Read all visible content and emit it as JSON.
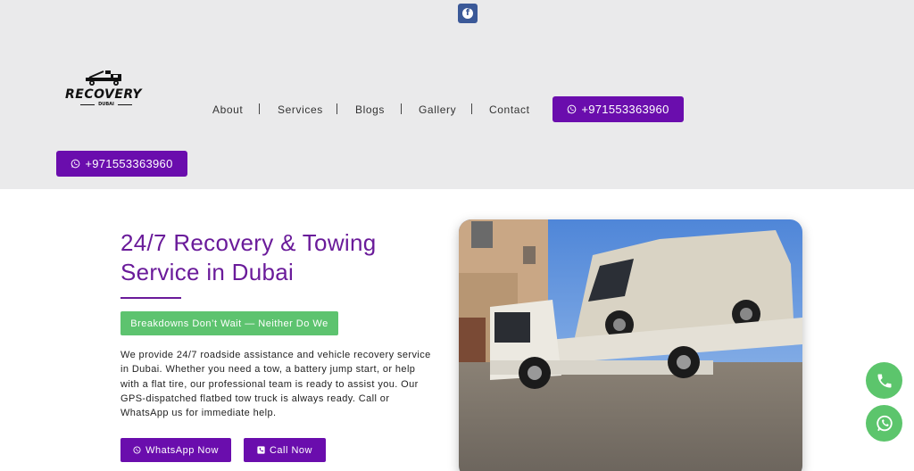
{
  "social": {
    "facebook_icon": "facebook-icon"
  },
  "logo": {
    "title": "RECOVERY",
    "subtitle": "DUBAI"
  },
  "nav": {
    "items": [
      "About",
      "Services",
      "Blogs",
      "Gallery",
      "Contact"
    ]
  },
  "header_phone": "+971553363960",
  "sub_phone": "+971553363960",
  "hero": {
    "title_line1": "24/7 Recovery & Towing",
    "title_line2": "Service in Dubai",
    "tagline": "Breakdowns Don’t Wait — Neither Do We",
    "description": "We provide 24/7 roadside assistance and vehicle recovery service in Dubai. Whether you need a tow, a battery jump start, or help with a flat tire, our professional team is ready to assist you. Our GPS-dispatched flatbed tow truck is always ready. Call or WhatsApp us for immediate help.",
    "whatsapp_label": "WhatsApp Now",
    "call_label": "Call Now"
  },
  "colors": {
    "brand_purple": "#6a0dad",
    "heading_purple": "#6a1b9a",
    "accent_green": "#5dc36f",
    "header_bg": "#eaeaeb",
    "facebook_blue": "#3b5998"
  },
  "floating": {
    "phone_icon": "phone-icon",
    "whatsapp_icon": "whatsapp-icon"
  }
}
